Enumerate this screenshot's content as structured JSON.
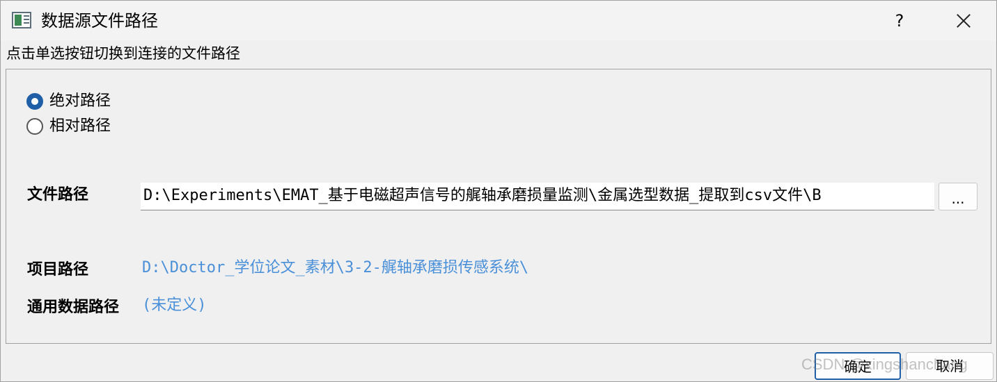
{
  "window": {
    "title": "数据源文件路径",
    "help_label": "?",
    "app_icon": "app-window-icon",
    "close_icon": "close-icon"
  },
  "instruction": "点击单选按钮切换到连接的文件路径",
  "path_mode": {
    "options": [
      {
        "label": "绝对路径",
        "checked": true
      },
      {
        "label": "相对路径",
        "checked": false
      }
    ]
  },
  "fields": {
    "file_path_label": "文件路径",
    "file_path_value": "D:\\Experiments\\EMAT_基于电磁超声信号的艉轴承磨损量监测\\金属选型数据_提取到csv文件\\B",
    "browse_label": "...",
    "project_path_label": "项目路径",
    "project_path_value": "D:\\Doctor_学位论文_素材\\3-2-艉轴承磨损传感系统\\",
    "common_path_label": "通用数据路径",
    "common_path_value": "(未定义)"
  },
  "buttons": {
    "ok": "确定",
    "cancel": "取消"
  },
  "watermark": "CSDN @xingshanchang",
  "colors": {
    "accent": "#1f5fa8",
    "link": "#4a90d9"
  }
}
